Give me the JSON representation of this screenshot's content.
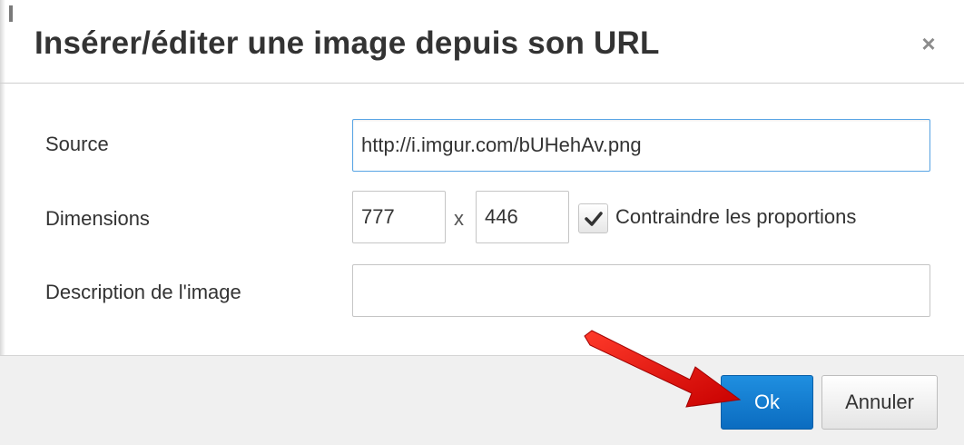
{
  "dialog": {
    "title": "Insérer/éditer une image depuis son URL",
    "close_symbol": "×"
  },
  "form": {
    "source_label": "Source",
    "source_value": "http://i.imgur.com/bUHehAv.png",
    "dimensions_label": "Dimensions",
    "width_value": "777",
    "separator": "x",
    "height_value": "446",
    "constrain_label": "Contraindre les proportions",
    "constrain_checked": true,
    "description_label": "Description de l'image",
    "description_value": ""
  },
  "footer": {
    "ok_label": "Ok",
    "cancel_label": "Annuler"
  },
  "colors": {
    "primary_button": "#1479d0",
    "focus_border": "#59a5e5",
    "arrow": "#e01010"
  },
  "icons": {
    "close": "close-icon",
    "check": "checkmark-icon",
    "annotation": "red-arrow-icon"
  }
}
